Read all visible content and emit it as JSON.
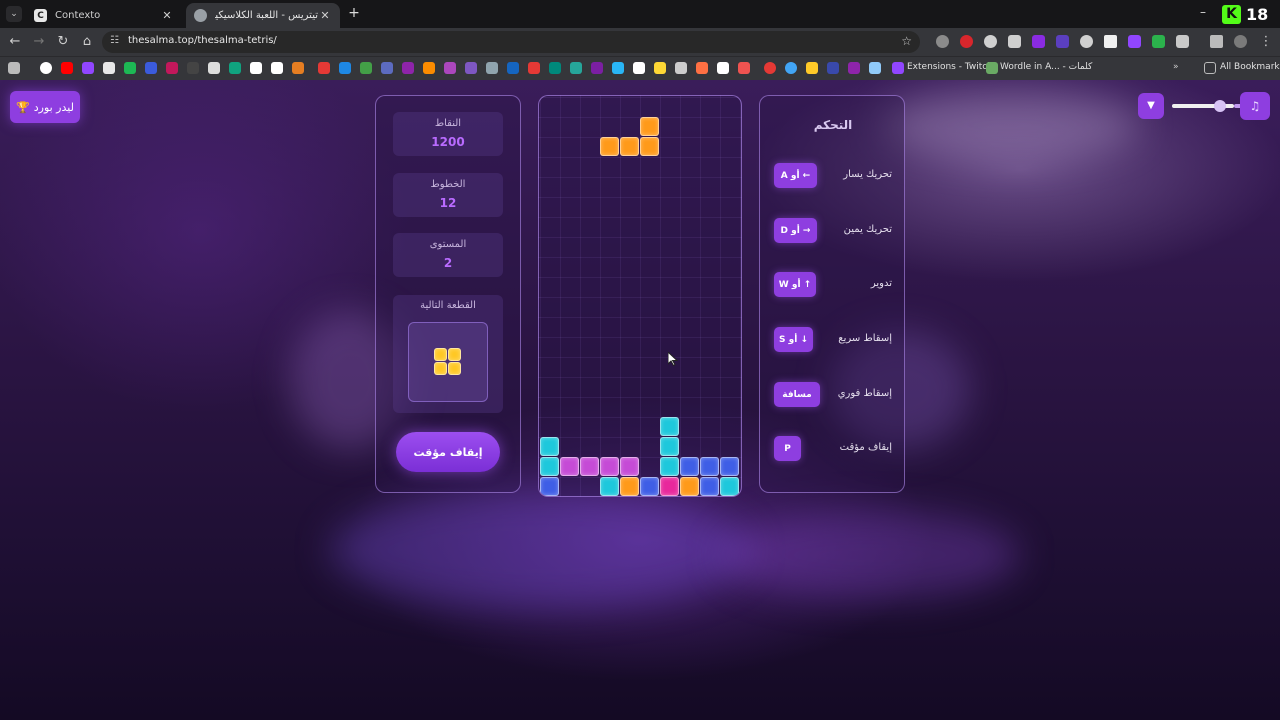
{
  "browser": {
    "tabs": [
      {
        "title": "Contexto",
        "favicon": "C",
        "active": false
      },
      {
        "title": "تيتريس - اللعبة الكلاسيكية",
        "favicon": "",
        "active": true
      }
    ],
    "url": "thesalma.top/thesalma-tetris/",
    "bookmarks": {
      "twitch_label": "Extensions - Twitch",
      "wordle_label": "Wordle in A... - كلمات",
      "all_label": "All Bookmarks"
    },
    "badge_number": "18"
  },
  "page": {
    "leaderboard_label": "ليدر بورد",
    "stats": {
      "score_label": "النقاط",
      "score_value": "1200",
      "lines_label": "الخطوط",
      "lines_value": "12",
      "level_label": "المستوى",
      "level_value": "2",
      "next_label": "القطعة التالية"
    },
    "pause_button": "إيقاف مؤقت",
    "controls": {
      "title": "التحكم",
      "rows": [
        {
          "action": "تحريك يسار",
          "key": "A أو ←"
        },
        {
          "action": "تحريك يمين",
          "key": "D أو →"
        },
        {
          "action": "تدوير",
          "key": "W أو ↑"
        },
        {
          "action": "إسقاط سريع",
          "key": "S أو ↓"
        },
        {
          "action": "إسقاط فوري",
          "key": "مسافة"
        },
        {
          "action": "إيقاف مؤقت",
          "key": "P"
        }
      ]
    },
    "volume_level": 0.8,
    "colors": {
      "accent": "#8e3ee0",
      "cyan": "#1ec8dc",
      "orange": "#ff9a1a",
      "magenta": "#c54bd6",
      "blue": "#3f5ee6",
      "pink": "#e8289c",
      "yellow": "#ffc824"
    },
    "board": {
      "cols": 10,
      "rows": 20,
      "active_piece": {
        "color": "orange",
        "cells": [
          [
            5,
            1
          ],
          [
            3,
            2
          ],
          [
            4,
            2
          ],
          [
            5,
            2
          ]
        ]
      },
      "locked_cells": [
        {
          "c": 6,
          "r": 16,
          "color": "cyan"
        },
        {
          "c": 0,
          "r": 17,
          "color": "cyan"
        },
        {
          "c": 6,
          "r": 17,
          "color": "cyan"
        },
        {
          "c": 0,
          "r": 18,
          "color": "cyan"
        },
        {
          "c": 1,
          "r": 18,
          "color": "magenta"
        },
        {
          "c": 2,
          "r": 18,
          "color": "magenta"
        },
        {
          "c": 3,
          "r": 18,
          "color": "magenta"
        },
        {
          "c": 4,
          "r": 18,
          "color": "magenta"
        },
        {
          "c": 6,
          "r": 18,
          "color": "cyan"
        },
        {
          "c": 7,
          "r": 18,
          "color": "blue"
        },
        {
          "c": 8,
          "r": 18,
          "color": "blue"
        },
        {
          "c": 9,
          "r": 18,
          "color": "blue"
        },
        {
          "c": 0,
          "r": 19,
          "color": "blue"
        },
        {
          "c": 3,
          "r": 19,
          "color": "cyan"
        },
        {
          "c": 4,
          "r": 19,
          "color": "orange"
        },
        {
          "c": 5,
          "r": 19,
          "color": "blue"
        },
        {
          "c": 6,
          "r": 19,
          "color": "pink"
        },
        {
          "c": 7,
          "r": 19,
          "color": "orange"
        },
        {
          "c": 8,
          "r": 19,
          "color": "blue"
        },
        {
          "c": 9,
          "r": 19,
          "color": "cyan"
        }
      ],
      "next_piece": {
        "color": "yellow",
        "cells": [
          [
            0,
            0
          ],
          [
            1,
            0
          ],
          [
            0,
            1
          ],
          [
            1,
            1
          ]
        ]
      }
    }
  }
}
